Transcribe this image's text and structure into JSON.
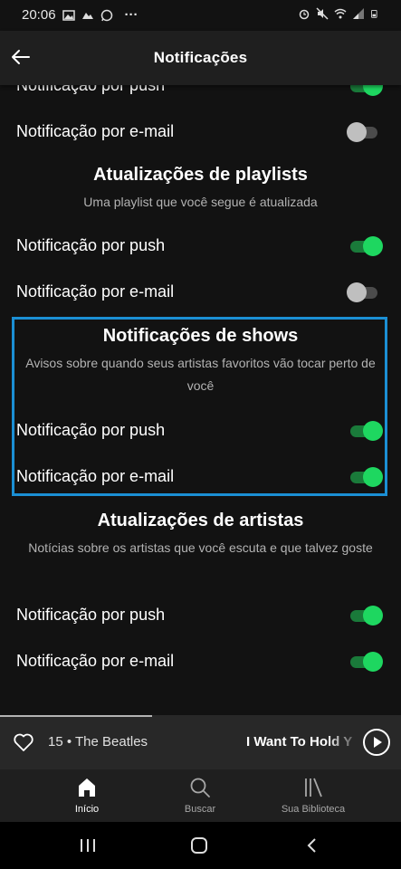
{
  "status_bar": {
    "time": "20:06",
    "more": "···"
  },
  "header": {
    "title": "Notificações"
  },
  "sections": {
    "top": {
      "push_label": "Notificação por push",
      "push_on": true,
      "email_label": "Notificação por e-mail",
      "email_on": false
    },
    "playlists": {
      "title": "Atualizações de playlists",
      "description": "Uma playlist que você segue é atualizada",
      "push_label": "Notificação por push",
      "push_on": true,
      "email_label": "Notificação por e-mail",
      "email_on": false
    },
    "shows": {
      "title": "Notificações de shows",
      "description": "Avisos sobre quando seus artistas favoritos vão tocar perto de você",
      "push_label": "Notificação por push",
      "push_on": true,
      "email_label": "Notificação por e-mail",
      "email_on": true
    },
    "artists": {
      "title": "Atualizações de artistas",
      "description": "Notícias sobre os artistas que você escuta e que talvez goste",
      "push_label": "Notificação por push",
      "push_on": true,
      "email_label": "Notificação por e-mail",
      "email_on": true
    }
  },
  "now_playing": {
    "artist_text": "15 • The Beatles",
    "track_text": "I Want To Hold Y",
    "progress_fraction": 0.38
  },
  "bottom_nav": {
    "home_label": "Início",
    "search_label": "Buscar",
    "library_label": "Sua Biblioteca"
  },
  "colors": {
    "background": "#121212",
    "header": "#1f1f1f",
    "toggle_on": "#1ed760",
    "toggle_off": "#bfbfbf",
    "highlight_border": "#1b8fd4"
  }
}
